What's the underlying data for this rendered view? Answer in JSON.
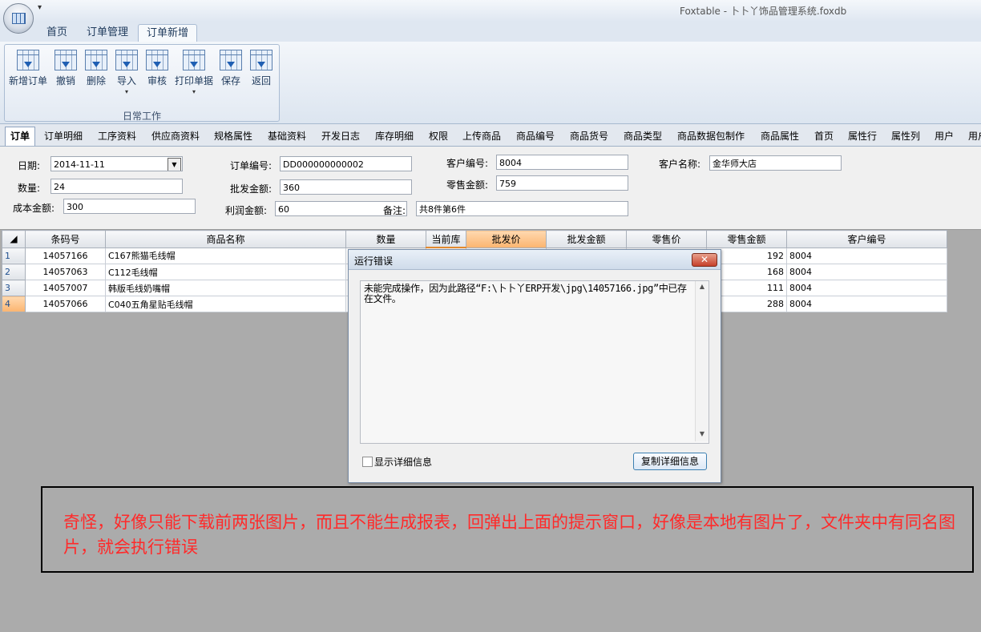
{
  "window": {
    "title": "Foxtable - 卜卜丫饰品管理系统.foxdb",
    "qat_arrow": "▾"
  },
  "ribbon": {
    "tabs": [
      {
        "label": "首页"
      },
      {
        "label": "订单管理"
      },
      {
        "label": "订单新增"
      }
    ],
    "group_label": "日常工作",
    "buttons": [
      {
        "label": "新增订单"
      },
      {
        "label": "撤销"
      },
      {
        "label": "删除"
      },
      {
        "label": "导入"
      },
      {
        "label": "审核"
      },
      {
        "label": "打印单据"
      },
      {
        "label": "保存"
      },
      {
        "label": "返回"
      }
    ],
    "dropdown_arrow": "▾"
  },
  "form_tabs": [
    "订单",
    "订单明细",
    "工序资料",
    "供应商资料",
    "规格属性",
    "基础资料",
    "开发日志",
    "库存明细",
    "权限",
    "上传商品",
    "商品编号",
    "商品货号",
    "商品类型",
    "商品数据包制作",
    "商品属性",
    "首页",
    "属性行",
    "属性列",
    "用户",
    "用户"
  ],
  "form": {
    "date_label": "日期:",
    "date_value": "2014-11-11",
    "order_no_label": "订单编号:",
    "order_no_value": "DD000000000002",
    "customer_no_label": "客户编号:",
    "customer_no_value": "8004",
    "customer_name_label": "客户名称:",
    "customer_name_value": "金华师大店",
    "qty_label": "数量:",
    "qty_value": "24",
    "wholesale_label": "批发金额:",
    "wholesale_value": "360",
    "retail_label": "零售金额:",
    "retail_value": "759",
    "cost_label": "成本金额:",
    "cost_value": "300",
    "profit_label": "利润金额:",
    "profit_value": "60",
    "note_label": "备注:",
    "note_value": "共8件第6件",
    "dropdown_glyph": "▼"
  },
  "grid": {
    "headers": [
      "条码号",
      "商品名称",
      "数量",
      "当前库",
      "批发价",
      "批发金额",
      "零售价",
      "零售金额",
      "客户编号"
    ],
    "rows": [
      {
        "num": "1",
        "barcode": "14057166",
        "name": "C167熊猫毛线帽",
        "retail_amount": "192",
        "customer": "8004"
      },
      {
        "num": "2",
        "barcode": "14057063",
        "name": "C112毛线帽",
        "retail_amount": "168",
        "customer": "8004"
      },
      {
        "num": "3",
        "barcode": "14057007",
        "name": "韩版毛线奶嘴帽",
        "retail_amount": "111",
        "customer": "8004"
      },
      {
        "num": "4",
        "barcode": "14057066",
        "name": "C040五角星贴毛线帽",
        "retail_amount": "288",
        "customer": "8004"
      }
    ]
  },
  "dialog": {
    "title": "运行错误",
    "close_glyph": "✕",
    "message": "未能完成操作，因为此路径“F:\\卜卜丫ERP开发\\jpg\\14057166.jpg”中已存在文件。",
    "scroll_up": "▲",
    "scroll_down": "▼",
    "show_details": "显示详细信息",
    "copy_button": "复制详细信息"
  },
  "annotation": {
    "text": "奇怪，好像只能下载前两张图片，而且不能生成报表，回弹出上面的提示窗口，好像是本地有图片了，文件夹中有同名图片，就会执行错误"
  }
}
